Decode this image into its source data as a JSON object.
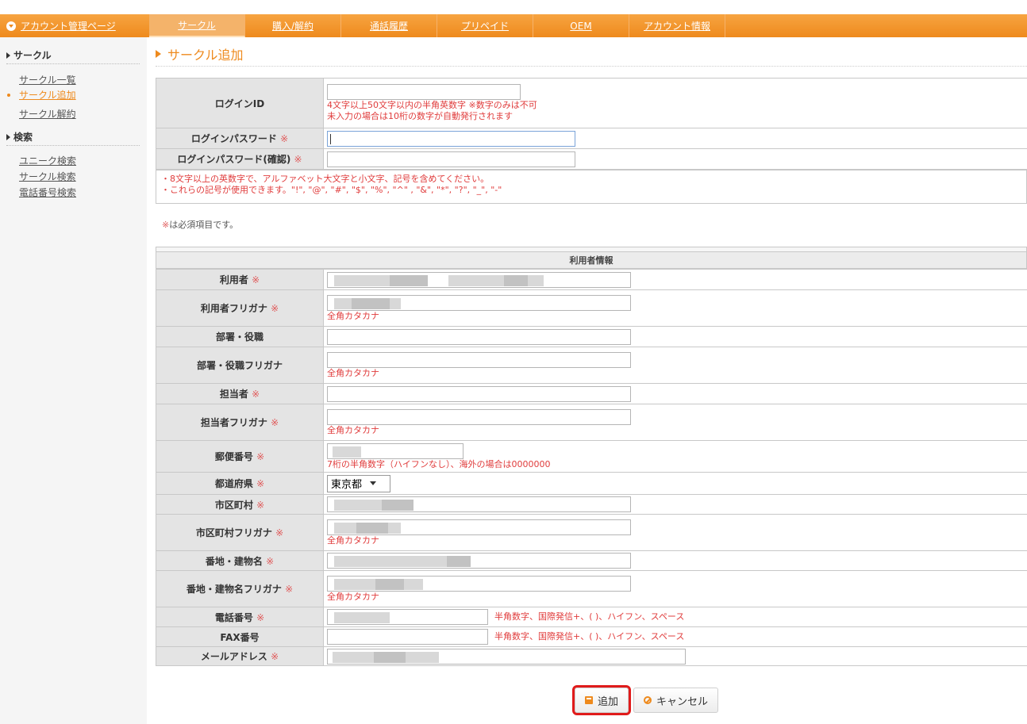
{
  "nav": {
    "brand": "アカウント管理ページ",
    "tabs": [
      "サークル",
      "購入/解約",
      "通話履歴",
      "プリペイド",
      "OEM",
      "アカウント情報"
    ]
  },
  "sidebar": {
    "circle_head": "サークル",
    "circle_links": [
      "サークル一覧",
      "サークル追加",
      "サークル解約"
    ],
    "search_head": "検索",
    "search_links": [
      "ユニーク検索",
      "サークル検索",
      "電話番号検索"
    ]
  },
  "page": {
    "title": "サークル追加",
    "req_mark": "※",
    "required_note": "※は必須項目です。"
  },
  "login": {
    "id_label": "ログインID",
    "id_note1": "4文字以上50文字以内の半角英数字 ※数字のみは不可",
    "id_note2": "未入力の場合は10桁の数字が自動発行されます",
    "pw_label": "ログインパスワード",
    "pw2_label": "ログインパスワード(確認)",
    "pw_note1": "・8文字以上の英数字で、アルファベット大文字と小文字、記号を含めてください。",
    "pw_note2": "・これらの記号が使用できます。\"!\", \"@\", \"#\", \"$\", \"%\", \"^\" , \"&\", \"*\", \"?\", \"_\", \"-\""
  },
  "user_section": {
    "heading": "利用者情報",
    "katakana_note": "全角カタカナ",
    "postal_note": "7桁の半角数字（ハイフンなし）、海外の場合は0000000",
    "phone_note": "半角数字、国際発信+、( )、ハイフン、スペース",
    "prefecture_value": "東京都",
    "fields": {
      "user": "利用者",
      "user_kana": "利用者フリガナ",
      "dept": "部署・役職",
      "dept_kana": "部署・役職フリガナ",
      "contact": "担当者",
      "contact_kana": "担当者フリガナ",
      "postal": "郵便番号",
      "prefecture": "都道府県",
      "city": "市区町村",
      "city_kana": "市区町村フリガナ",
      "address": "番地・建物名",
      "address_kana": "番地・建物名フリガナ",
      "phone": "電話番号",
      "fax": "FAX番号",
      "email": "メールアドレス"
    }
  },
  "buttons": {
    "add": "追加",
    "cancel": "キャンセル"
  }
}
